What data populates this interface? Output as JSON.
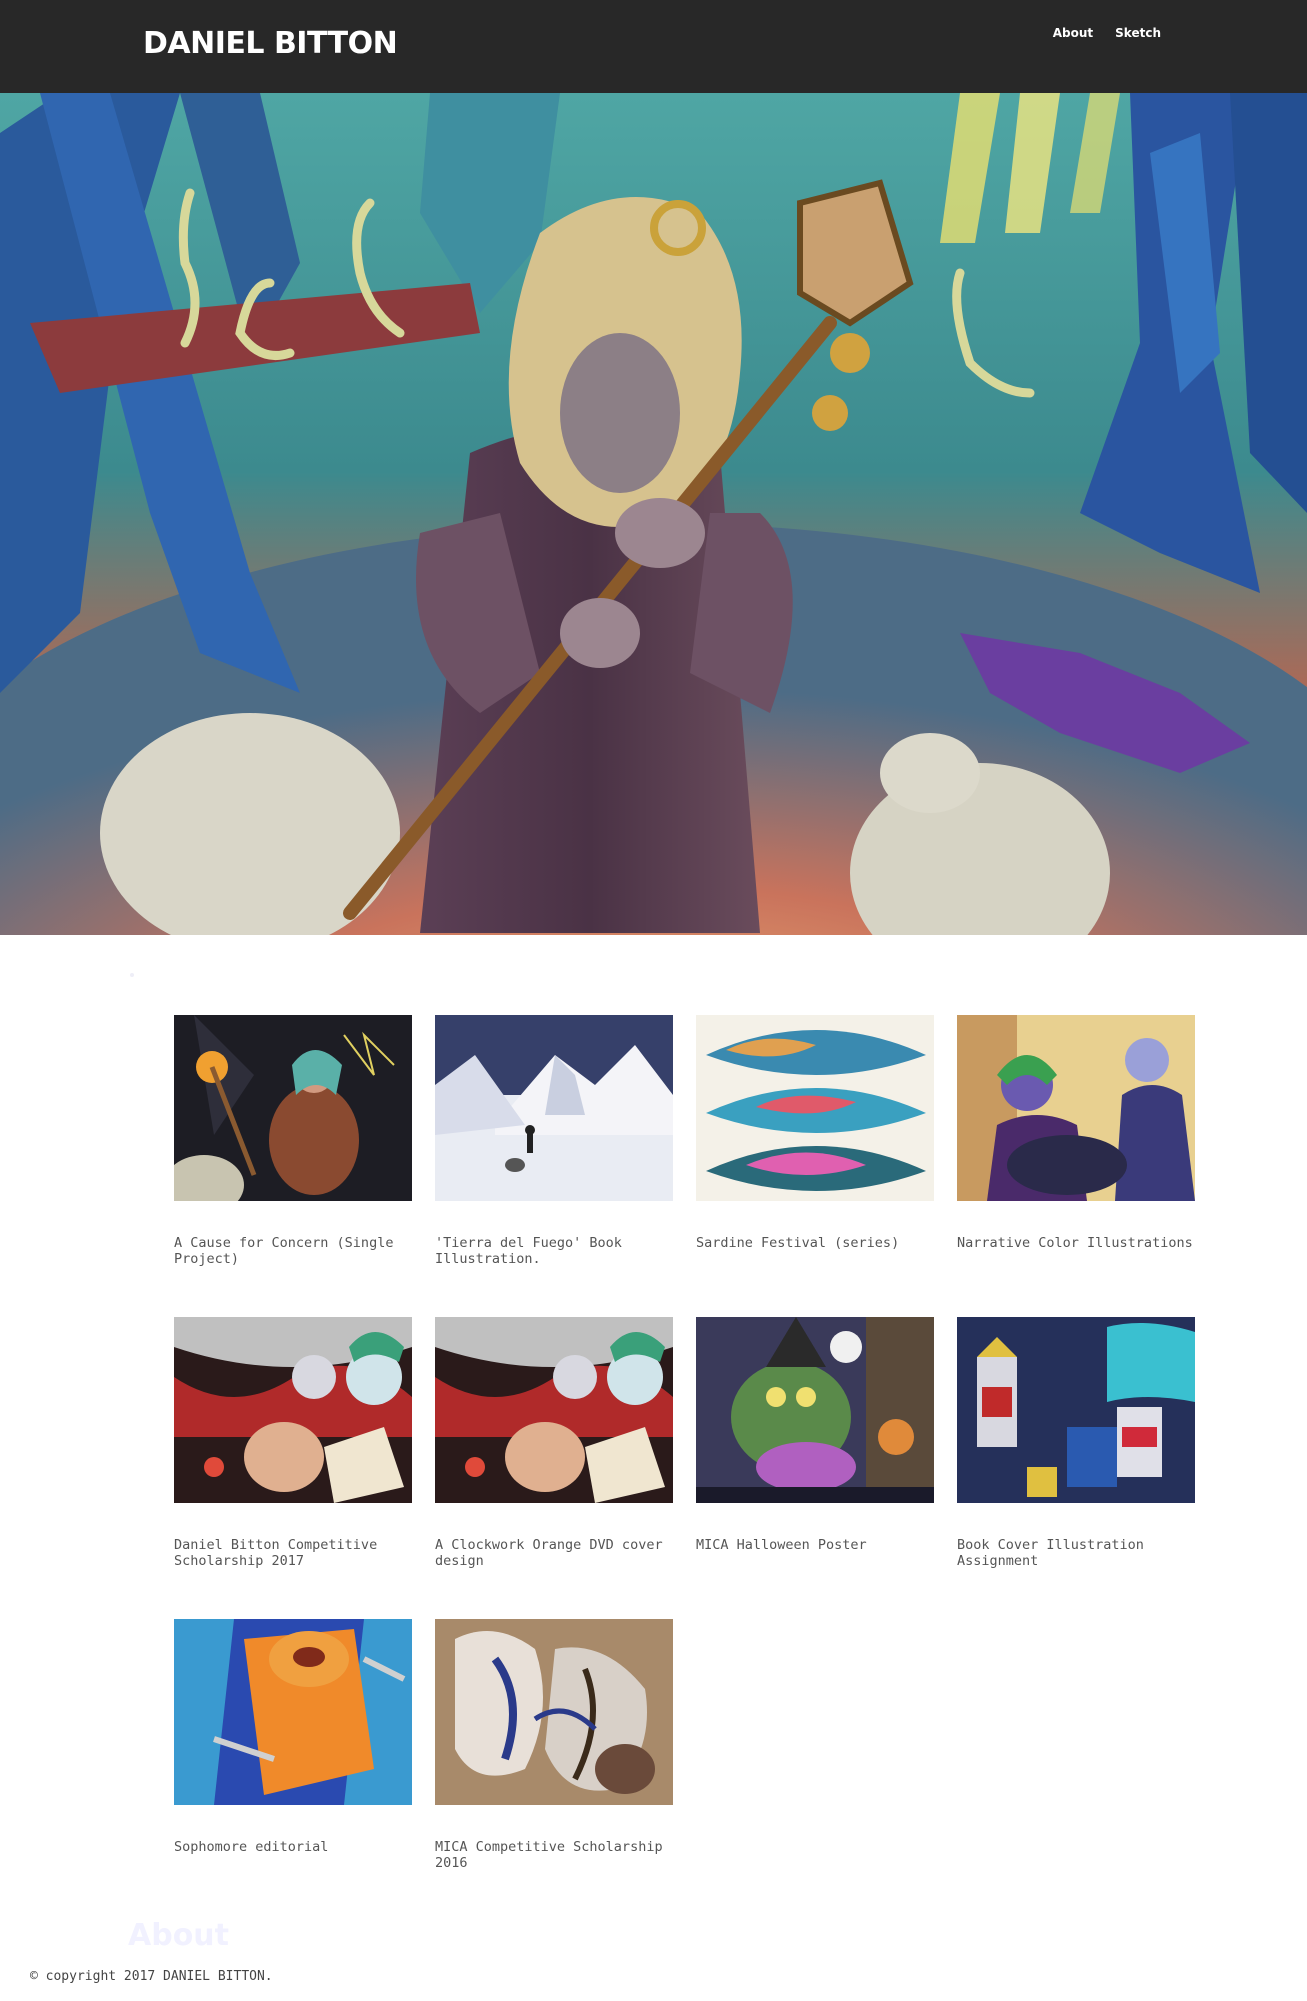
{
  "header": {
    "site_title": "DANIEL BITTON",
    "nav": [
      {
        "label": "About"
      },
      {
        "label": "Sketch"
      }
    ]
  },
  "hero": {
    "image": "illustration of a robed figure in an animal-skull hood holding a lantern staff in a forest with herons and sheep"
  },
  "gallery": {
    "items": [
      {
        "title": "A Cause for Concern (Single Project)",
        "thumb": "woman-with-torch"
      },
      {
        "title": "'Tierra del Fuego' Book Illustration.",
        "thumb": "snowy-mountains"
      },
      {
        "title": "Sardine Festival (series)",
        "thumb": "sardines"
      },
      {
        "title": "Narrative Color Illustrations",
        "thumb": "masked-figures"
      },
      {
        "title": "Daniel Bitton Competitive Scholarship 2017",
        "thumb": "clockwork-collage"
      },
      {
        "title": "A Clockwork Orange DVD cover design",
        "thumb": "clockwork-collage"
      },
      {
        "title": "MICA Halloween Poster",
        "thumb": "halloween-witch"
      },
      {
        "title": "Book Cover Illustration Assignment",
        "thumb": "robots"
      },
      {
        "title": "Sophomore editorial",
        "thumb": "orange-figure"
      },
      {
        "title": "MICA Competitive Scholarship 2016",
        "thumb": "abstract-figures"
      }
    ]
  },
  "about_heading": "About",
  "footer": {
    "copyright": "© copyright 2017 DANIEL BITTON."
  }
}
